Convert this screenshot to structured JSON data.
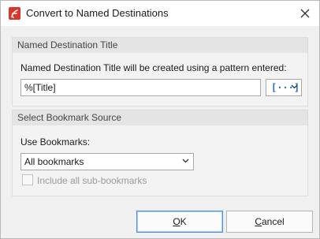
{
  "window": {
    "title": "Convert to Named Destinations",
    "icons": {
      "app": "app-logo-icon",
      "close": "close-icon"
    }
  },
  "named_destination_group": {
    "header": "Named Destination Title",
    "description": "Named Destination Title will be created using a pattern entered:",
    "pattern_value": "%[Title]",
    "macro_button_glyph": "[···]"
  },
  "bookmark_source_group": {
    "header": "Select Bookmark Source",
    "use_bookmarks_label": "Use Bookmarks:",
    "bookmarks_selected": "All bookmarks",
    "include_sub_label": "Include all sub-bookmarks",
    "include_sub_checked": false,
    "include_sub_enabled": false
  },
  "buttons": {
    "ok_accel": "O",
    "ok_rest": "K",
    "cancel_accel": "C",
    "cancel_rest": "ancel"
  },
  "colors": {
    "accent": "#1e6fd0",
    "app_icon": "#d9352b",
    "default_button_border": "#4a8fe0"
  }
}
